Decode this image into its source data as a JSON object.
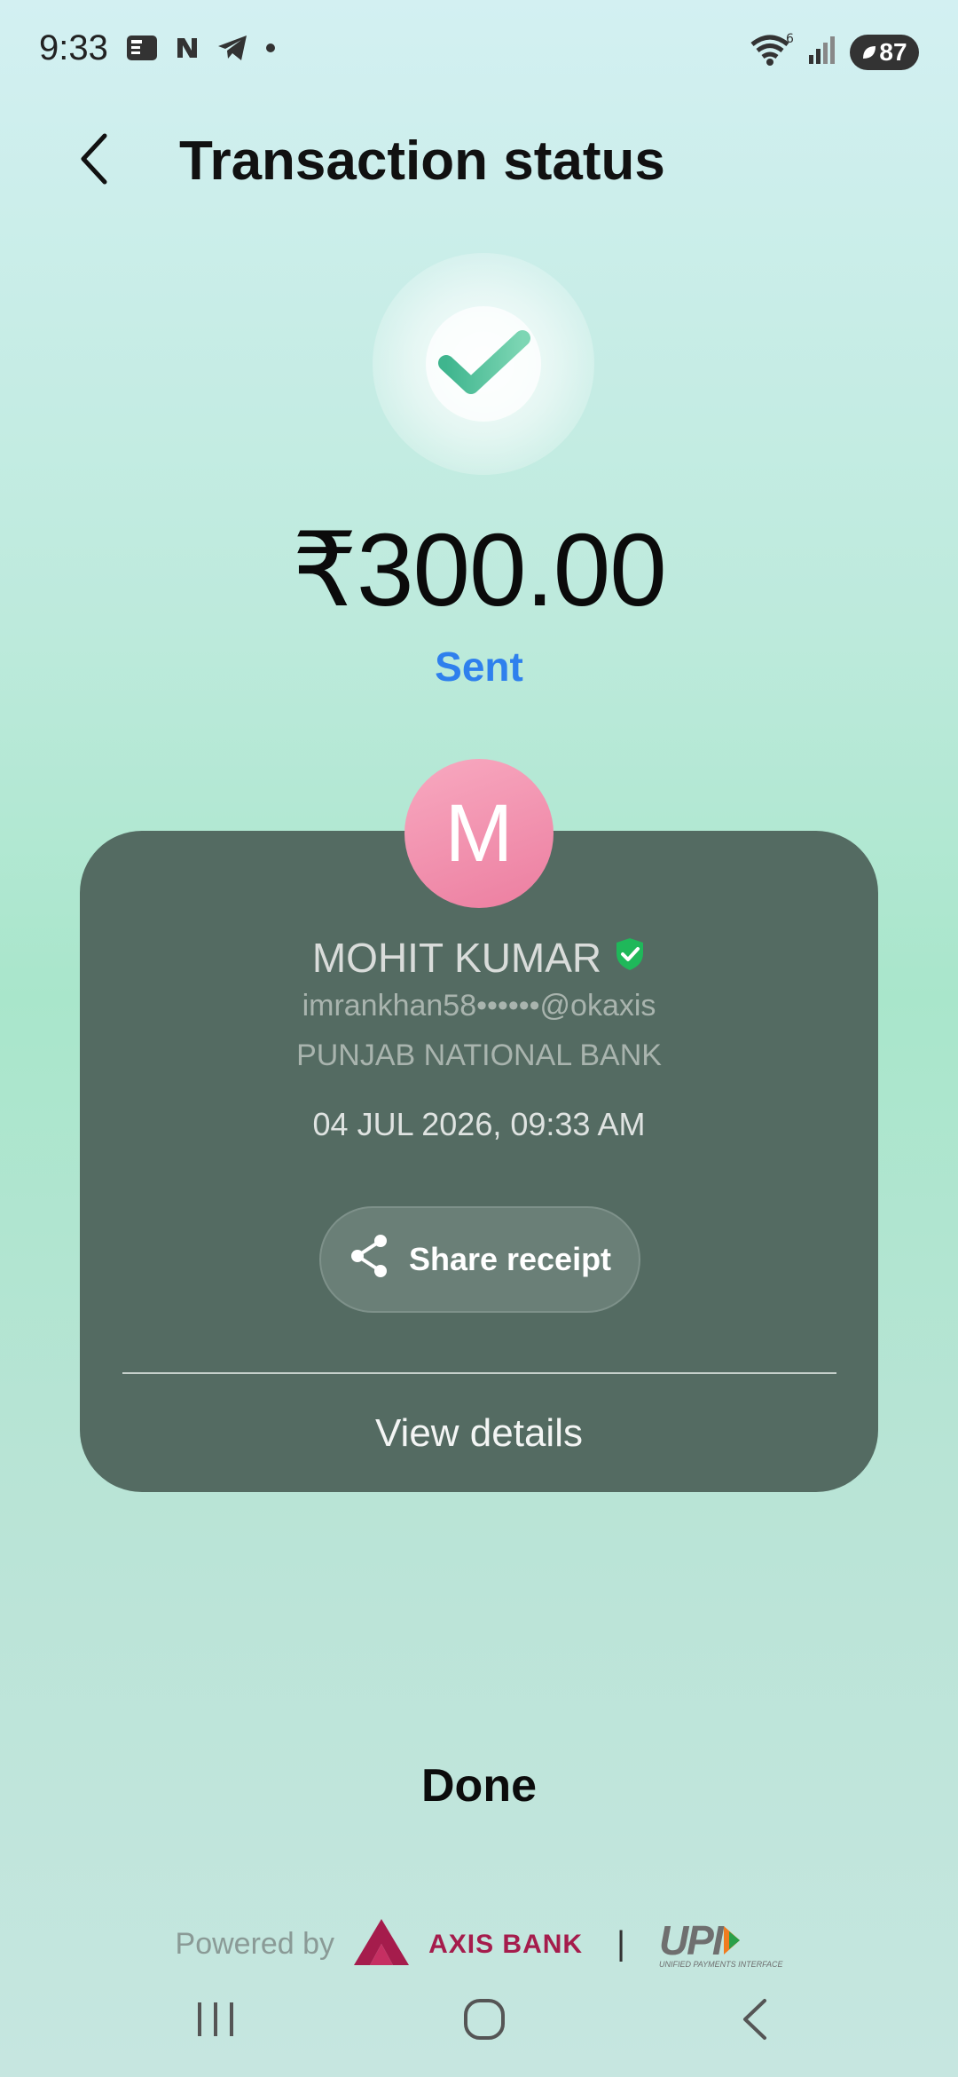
{
  "status_bar": {
    "time": "9:33",
    "battery": "87",
    "network_badge": "6"
  },
  "header": {
    "title": "Transaction status"
  },
  "transaction": {
    "amount": "₹300.00",
    "status": "Sent"
  },
  "recipient": {
    "avatar_letter": "M",
    "name": "MOHIT KUMAR",
    "upi_id": "imrankhan58••••••@okaxis",
    "bank": "PUNJAB NATIONAL BANK",
    "datetime": "04 JUL 2026, 09:33 AM"
  },
  "actions": {
    "share_receipt": "Share receipt",
    "view_details": "View details",
    "done": "Done"
  },
  "footer": {
    "powered_by": "Powered by",
    "bank_brand": "AXIS BANK",
    "separator": "|",
    "upi_brand": "UPI",
    "upi_subtitle": "UNIFIED PAYMENTS INTERFACE"
  },
  "colors": {
    "accent_blue": "#2f80ed",
    "card_bg": "#546b62",
    "success_green": "#4dbf9a",
    "verified_green": "#1fb85a",
    "axis_maroon": "#a51c4c"
  }
}
